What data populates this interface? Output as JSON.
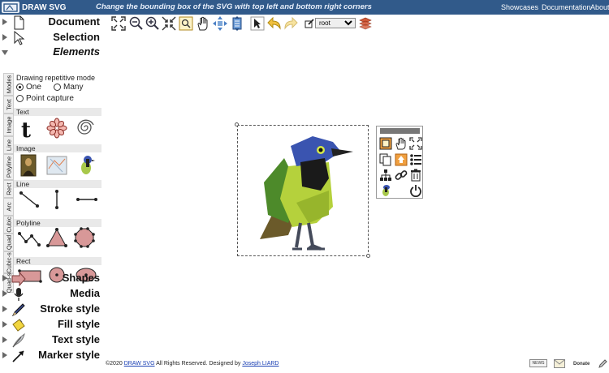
{
  "app": {
    "logo_text": "DRAW SVG",
    "tagline": "Change the bounding box of the SVG with top left and bottom right corners",
    "links": [
      "Showcases",
      "Documentation",
      "About"
    ]
  },
  "sidebar": {
    "sections": [
      {
        "label": "Document",
        "icon": "document-icon"
      },
      {
        "label": "Selection",
        "icon": "cursor-icon"
      },
      {
        "label": "Elements",
        "icon": "elements-icon"
      },
      {
        "label": "Shapes",
        "icon": "arrow-shape-icon"
      },
      {
        "label": "Media",
        "icon": "microphone-icon"
      },
      {
        "label": "Stroke style",
        "icon": "pen-icon"
      },
      {
        "label": "Fill style",
        "icon": "paint-bucket-icon"
      },
      {
        "label": "Text style",
        "icon": "feather-icon"
      },
      {
        "label": "Marker style",
        "icon": "marker-arrow-icon"
      }
    ],
    "vertical_tabs": [
      "Modes",
      "Text",
      "Image",
      "Line",
      "Polyline",
      "Rect",
      "Arc",
      "Cubic",
      "Quad",
      "Cubic-s",
      "Quad-s"
    ],
    "modes": {
      "heading": "Drawing repetitive mode",
      "options": [
        "One",
        "Many",
        "Point capture"
      ],
      "selected": "One"
    },
    "groups": {
      "text": "Text",
      "image": "Image",
      "line": "Line",
      "polyline": "Polyline",
      "rect": "Rect"
    }
  },
  "toolbar": {
    "layer_select": "root",
    "icons": [
      "fit-to-screen-icon",
      "zoom-out-icon",
      "zoom-in-icon",
      "shrink-icon",
      "zoom-selection-icon",
      "hand-icon",
      "pan-arrows-icon",
      "fit-page-icon",
      "select-arrow-icon",
      "undo-icon",
      "redo-icon",
      "edit-icon",
      "layers-icon"
    ]
  },
  "context_menu": {
    "icons": [
      "bounding-box-icon",
      "hand-icon",
      "fullscreen-icon",
      "copy-icon",
      "export-icon",
      "list-icon",
      "hierarchy-icon",
      "link-icon",
      "trash-icon",
      "bird-thumbnail-icon",
      "power-icon"
    ]
  },
  "footer": {
    "prefix": "©2020",
    "brand_link": "DRAW SVG",
    "middle": "All Rights Reserved. Designed by",
    "author_link": "Joseph LIARD"
  },
  "bottom_right": {
    "news": "NEWS",
    "donate": "Donate"
  },
  "colors": {
    "topbar": "#315a8a",
    "accent_orange": "#f0a040"
  }
}
